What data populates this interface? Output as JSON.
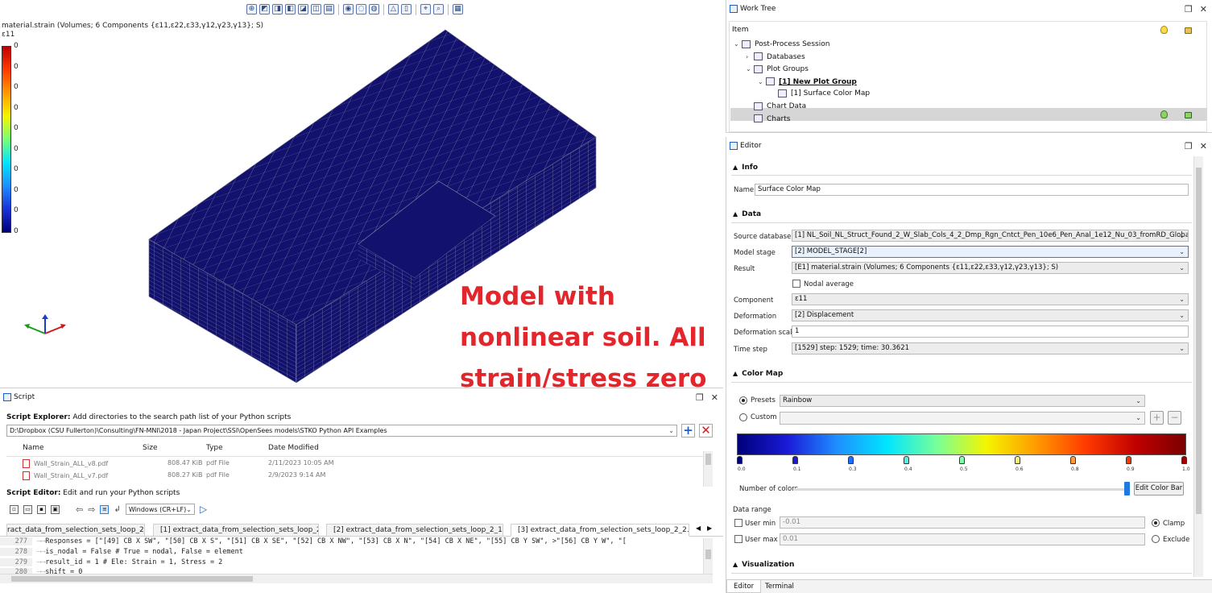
{
  "viewport": {
    "result_title": "material.strain (Volumes; 6 Components {ε11,ε22,ε33,γ12,γ23,γ13}; S)",
    "component_label": "ε11",
    "legend_values": [
      "0",
      "0",
      "0",
      "0",
      "0",
      "0",
      "0",
      "0",
      "0",
      "0"
    ],
    "annotation": "Model with nonlinear soil. All strain/stress zero",
    "toolbar_icons": [
      "view-iso-icon",
      "view-front-icon",
      "view-back-icon",
      "view-left-icon",
      "view-right-icon",
      "view-top-icon",
      "view-bottom-icon",
      "show-icon",
      "hide-icon",
      "hide-others-icon",
      "perspective-icon",
      "parallel-icon",
      "zoom-fit-icon",
      "zoom-icon",
      "grid-icon"
    ],
    "colors": {
      "mesh_fill": "#12126e",
      "mesh_line": "#9a9aae",
      "annotation": "#e3262b"
    }
  },
  "script": {
    "title": "Script",
    "explorer_label_bold": "Script Explorer:",
    "explorer_label_text": " Add directories to the search path list of your Python scripts",
    "directory": "D:\\Dropbox (CSU Fullerton)\\Consulting\\FN-MNI\\2018 - Japan Project\\SSI\\OpenSees models\\STKO Python API Examples",
    "file_columns": [
      "Name",
      "Size",
      "Type",
      "Date Modified"
    ],
    "files": [
      {
        "name": "Wall_Strain_ALL_v8.pdf",
        "size": "808.47 KiB",
        "type": "pdf File",
        "date": "2/11/2023 10:05 AM"
      },
      {
        "name": "Wall_Strain_ALL_v7.pdf",
        "size": "808.27 KiB",
        "type": "pdf File",
        "date": "2/9/2023 9:14 AM"
      }
    ],
    "editor_label_bold": "Script Editor:",
    "editor_label_text": " Edit and run your Python scripts",
    "line_ending": "Windows (CR+LF)",
    "tabs": [
      {
        "label": "ract_data_from_selection_sets_loop_2_1",
        "active": false
      },
      {
        "label": "[1] extract_data_from_selection_sets_loop_2_2",
        "active": false
      },
      {
        "label": "[2] extract_data_from_selection_sets_loop_2_1.cb",
        "active": false
      },
      {
        "label": "[3] extract_data_from_selection_sets_loop_2_2.cb",
        "active": true
      }
    ],
    "code_lines": [
      {
        "no": "277",
        "indent": "⟶⟶",
        "code": "Responses = [\"[49] CB X SW\", \"[50] CB X S\", \"[51] CB X SE\", \"[52] CB X NW\", \"[53] CB X N\", \"[54] CB X NE\", \"[55] CB Y SW\", >\"[56] CB Y W\", \"["
      },
      {
        "no": "278",
        "indent": "⟶⟶",
        "code": "is_nodal = False # True = nodal, False = element"
      },
      {
        "no": "279",
        "indent": "⟶⟶",
        "code": "result_id = 1 # Ele: Strain = 1, Stress = 2"
      },
      {
        "no": "280",
        "indent": "⟶⟶",
        "code": "shift = 0"
      }
    ]
  },
  "work_tree": {
    "title": "Work Tree",
    "column_item": "Item",
    "nodes": [
      {
        "label": "Post-Process Session",
        "level": 0,
        "chev": "⌄",
        "icon": "session-icon"
      },
      {
        "label": "Databases",
        "level": 1,
        "chev": "›",
        "icon": "database-icon"
      },
      {
        "label": "Plot Groups",
        "level": 1,
        "chev": "⌄",
        "icon": "plot-groups-icon"
      },
      {
        "label": "[1] New Plot Group",
        "level": 2,
        "chev": "⌄",
        "icon": "plot-group-icon"
      },
      {
        "label": "[1] Surface Color Map",
        "level": 3,
        "chev": "",
        "icon": "color-map-icon"
      },
      {
        "label": "Chart Data",
        "level": 1,
        "chev": "",
        "icon": "chart-data-icon"
      },
      {
        "label": "Charts",
        "level": 1,
        "chev": "",
        "icon": "charts-icon"
      }
    ]
  },
  "editor": {
    "title": "Editor",
    "sections": {
      "info": "Info",
      "data": "Data",
      "color_map": "Color Map",
      "visualization": "Visualization"
    },
    "name_label": "Name",
    "name_value": "Surface Color Map",
    "source_db_label": "Source database",
    "source_db_value": "[1] NL_Soil_NL_Struct_Found_2_W_Slab_Cols_4_2_Dmp_Rgn_Cntct_Pen_10e6_Pen_Anal_1e12_Nu_03_fromRD_Global_Grav",
    "model_stage_label": "Model stage",
    "model_stage_value": "[2] MODEL_STAGE[2]",
    "result_label": "Result",
    "result_value": "[E1] material.strain (Volumes; 6 Components {ε11,ε22,ε33,γ12,γ23,γ13}; S)",
    "nodal_average_label": "Nodal average",
    "component_label": "Component",
    "component_value": "ε11",
    "deformation_label": "Deformation",
    "deformation_value": "[2] Displacement",
    "deformation_scale_label": "Deformation scale",
    "deformation_scale_value": "1",
    "time_step_label": "Time step",
    "time_step_value": "[1529] step: 1529; time: 30.3621",
    "presets_label": "Presets",
    "presets_value": "Rainbow",
    "custom_label": "Custom",
    "colormap_stops": [
      "0.0",
      "0.1",
      "0.3",
      "0.4",
      "0.5",
      "0.6",
      "0.8",
      "0.9",
      "1.0"
    ],
    "stop_colors": [
      "#00007a",
      "#1a1ad8",
      "#1e6fff",
      "#55f0e0",
      "#88ffaa",
      "#f5f570",
      "#ff9a40",
      "#ff3a00",
      "#a00000"
    ],
    "number_of_colors_label": "Number of colors",
    "edit_color_bar": "Edit Color Bar",
    "data_range_label": "Data range",
    "user_min_label": "User min",
    "user_min_value": "-0.01",
    "user_max_label": "User max",
    "user_max_value": "0.01",
    "clamp_label": "Clamp",
    "exclude_label": "Exclude",
    "bottom_tabs": [
      "Editor",
      "Terminal"
    ]
  }
}
